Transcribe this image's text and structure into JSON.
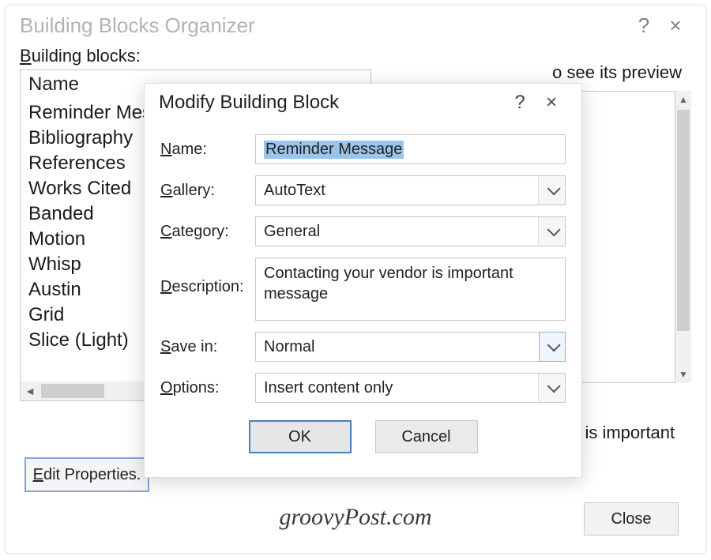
{
  "parent_dialog": {
    "title": "Building Blocks Organizer",
    "help_glyph": "?",
    "close_glyph": "×",
    "building_blocks_label": "Building blocks:",
    "preview_hint_suffix": "o see its preview",
    "column_header": "Name",
    "items": [
      "Reminder Mes",
      "Bibliography",
      "References",
      "Works Cited",
      "Banded",
      "Motion",
      "Whisp",
      "Austin",
      "Grid",
      "Slice (Light)"
    ],
    "preview_desc_suffix": "r is important",
    "edit_properties_label": "Edit Properties.",
    "close_label": "Close"
  },
  "modify_dialog": {
    "title": "Modify Building Block",
    "help_glyph": "?",
    "close_glyph": "×",
    "labels": {
      "name": "ame:",
      "gallery": "allery:",
      "category": "ategory:",
      "description": "escription:",
      "save_in": "ave in:",
      "options": "ptions:"
    },
    "accelerators": {
      "name": "N",
      "gallery": "G",
      "category": "C",
      "description": "D",
      "save_in": "S",
      "options": "O"
    },
    "values": {
      "name": "Reminder Message",
      "gallery": "AutoText",
      "category": "General",
      "description": "Contacting your vendor is important message",
      "save_in": "Normal",
      "options": "Insert content only"
    },
    "ok_label": "OK",
    "cancel_label": "Cancel"
  },
  "watermark": "groovyPost.com"
}
